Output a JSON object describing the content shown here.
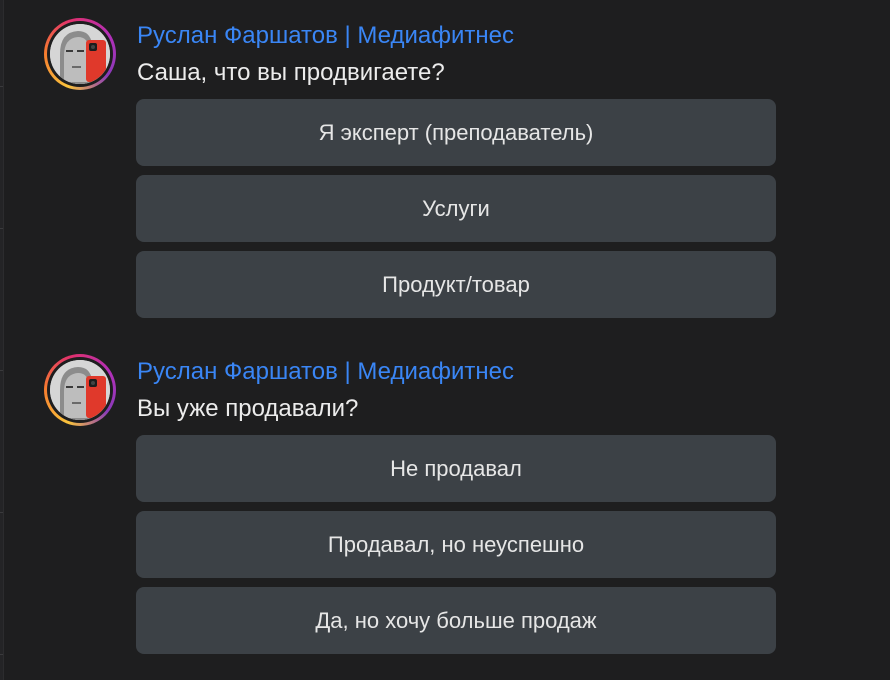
{
  "messages": [
    {
      "sender": "Руслан Фаршатов | Медиафитнес",
      "avatar_icon": "user-avatar-photo",
      "question": "Саша, что вы продвигаете?",
      "options": [
        "Я эксперт (преподаватель)",
        "Услуги",
        "Продукт/товар"
      ]
    },
    {
      "sender": "Руслан Фаршатов | Медиафитнес",
      "avatar_icon": "user-avatar-photo",
      "question": "Вы уже продавали?",
      "options": [
        "Не продавал",
        "Продавал, но неуспешно",
        "Да, но хочу больше продаж"
      ]
    }
  ],
  "colors": {
    "background": "#1e1e1f",
    "sender_name": "#3a86f5",
    "question_text": "#ececec",
    "option_background": "#3c4146",
    "option_text": "#e6e6e6"
  }
}
